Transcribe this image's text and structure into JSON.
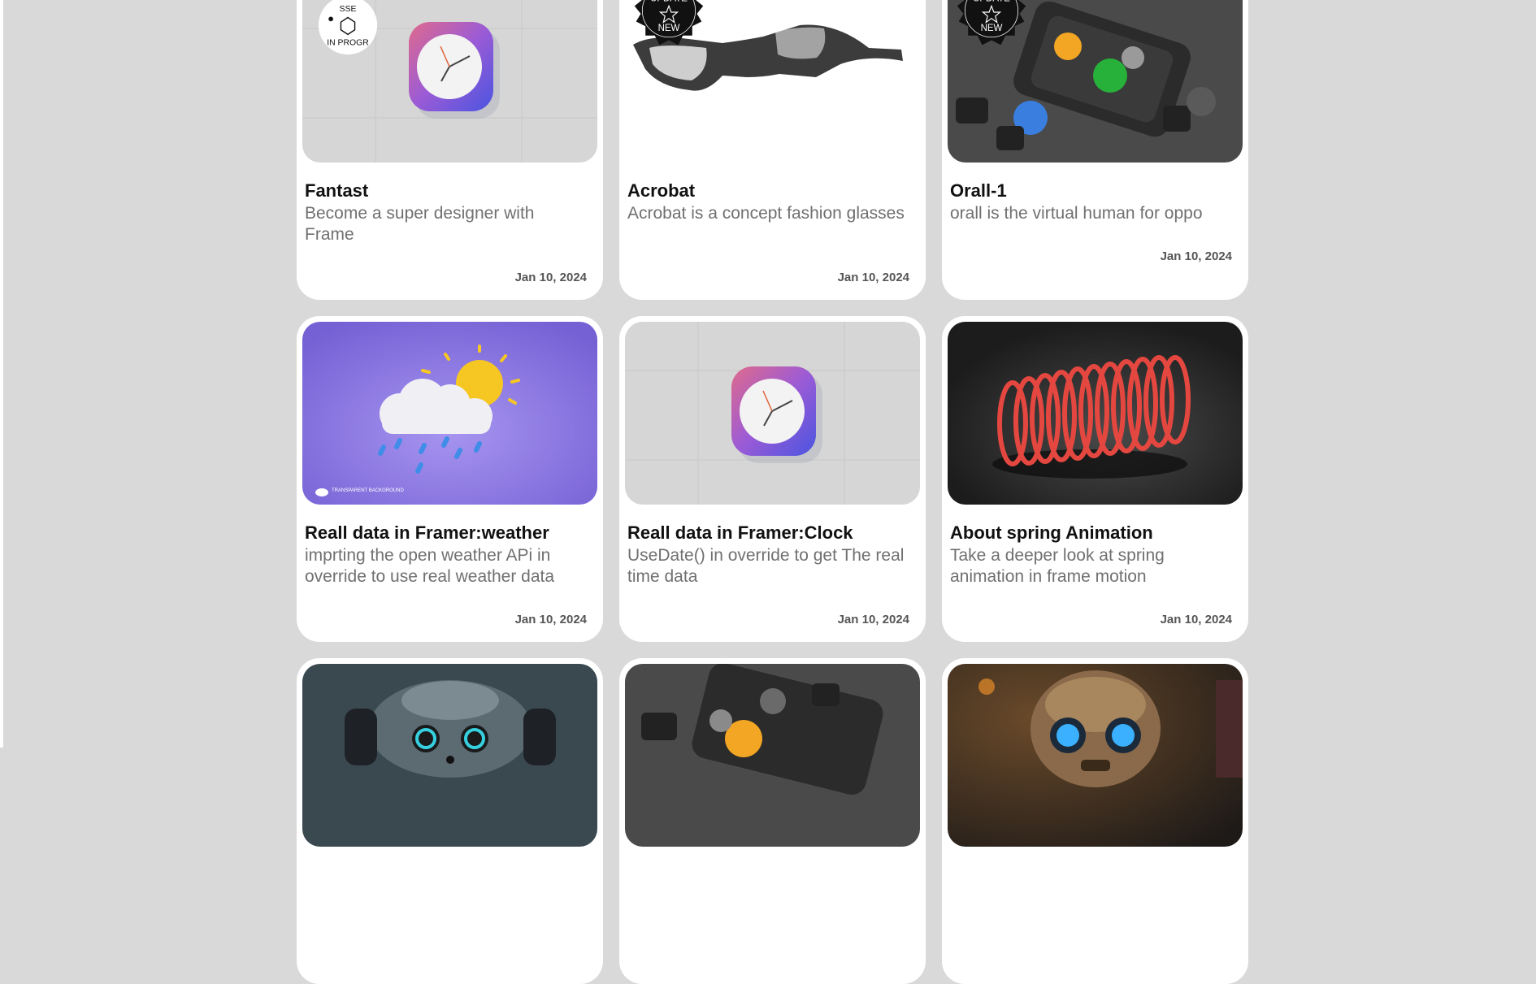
{
  "cards": [
    {
      "title": "Fantast",
      "desc": "Become a super designer with Frame",
      "date": "Jan 10, 2024",
      "badge": "IN PROGRESS",
      "image": "clock-icon"
    },
    {
      "title": "Acrobat",
      "desc": "Acrobat is a concept fashion glasses",
      "date": "Jan 10, 2024",
      "badge": "UPDATE NEW",
      "image": "glasses-icon"
    },
    {
      "title": "Orall-1",
      "desc": "orall is the virtual human for oppo",
      "date": "Jan 10, 2024",
      "badge": "UPDATE NEW",
      "image": "case-icon"
    },
    {
      "title": "Reall data in Framer:weather",
      "desc": "imprting the open weather APi in override to use real weather data",
      "date": "Jan 10, 2024",
      "image": "weather-icon",
      "caption": "TRANSPARENT BACKGROUND"
    },
    {
      "title": "Reall data in Framer:Clock",
      "desc": "UseDate() in override to get The real time data",
      "date": "Jan 10, 2024",
      "image": "clock-icon"
    },
    {
      "title": "About spring Animation",
      "desc": "Take a deeper look at spring animation in frame motion",
      "date": "Jan 10, 2024",
      "image": "spring-icon"
    },
    {
      "title": "",
      "desc": "",
      "date": "",
      "image": "robot-icon"
    },
    {
      "title": "",
      "desc": "",
      "date": "",
      "image": "case-icon"
    },
    {
      "title": "",
      "desc": "",
      "date": "",
      "image": "robot-head-icon"
    }
  ]
}
